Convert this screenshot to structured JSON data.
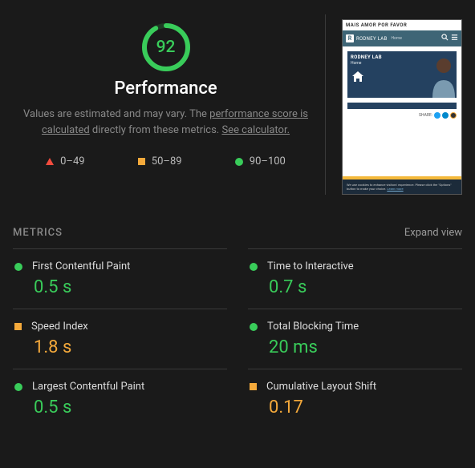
{
  "performance": {
    "score": "92",
    "title": "Performance",
    "description_1": "Values are estimated and may vary. The",
    "link_calc": "performance score is calculated",
    "description_2": "directly from these metrics.",
    "link_see": "See calculator."
  },
  "legend": {
    "range_low": "0–49",
    "range_mid": "50–89",
    "range_high": "90–100"
  },
  "preview": {
    "tagline": "MAIS AMOR POR FAVOR",
    "brand": "RODNEY LAB",
    "nav_home": "Home",
    "hero_title": "RODNEY LAB",
    "hero_sub": "Home",
    "share": "SHARE:",
    "cookie": "We use cookies to enhance visitors' experience. Please click the \"Options\" button to make your choice.",
    "cookie_link": "Learn more"
  },
  "metrics": {
    "header": "METRICS",
    "expand": "Expand view",
    "items": [
      {
        "name": "First Contentful Paint",
        "value": "0.5 s",
        "status": "green"
      },
      {
        "name": "Time to Interactive",
        "value": "0.7 s",
        "status": "green"
      },
      {
        "name": "Speed Index",
        "value": "1.8 s",
        "status": "orange"
      },
      {
        "name": "Total Blocking Time",
        "value": "20 ms",
        "status": "green"
      },
      {
        "name": "Largest Contentful Paint",
        "value": "0.5 s",
        "status": "green"
      },
      {
        "name": "Cumulative Layout Shift",
        "value": "0.17",
        "status": "orange"
      }
    ]
  }
}
